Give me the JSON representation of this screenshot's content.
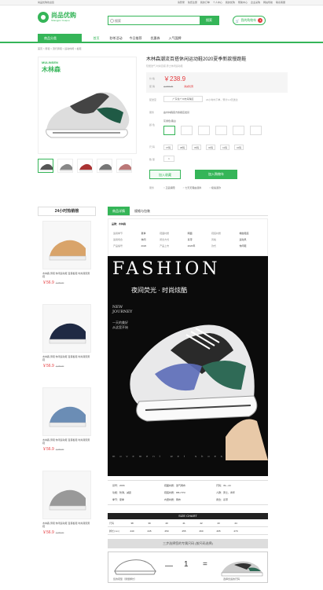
{
  "topbar": {
    "welcome": "尚品优购欢迎您",
    "links": [
      "请登录",
      "免费注册",
      "我的订单",
      "个人中心",
      "我的优购",
      "帮助中心",
      "企业采购",
      "网站导航",
      "联系客服"
    ]
  },
  "header": {
    "logo_name": "尚品优购",
    "logo_sub": "Shangpin Youqou",
    "search_placeholder": "搜索",
    "search_button": "搜索",
    "cart_label": "我的购物车",
    "cart_count": "8"
  },
  "nav": {
    "category": "商品分类",
    "items": [
      "首页",
      "秒杀活动",
      "今日推荐",
      "优惠券",
      "入气国牌"
    ]
  },
  "breadcrumb": "首页 > 男鞋 > 流行男鞋 > 运动休闲 > 板鞋",
  "gallery": {
    "brand_en": "MULINSEN",
    "brand_cn": "木林森"
  },
  "product": {
    "title": "木林森潮流百搭休闲运动鞋2020夏季新款慢跑鞋",
    "subtitle": "轻便透气 时尚百搭 男士休闲运动鞋",
    "price_label": "价 格",
    "price": "￥238.9",
    "orig_label": "促 销",
    "orig_price": "￥298.00",
    "promo_label": "满减优惠",
    "delivery_label": "配送至",
    "delivery_value": "广东省广州市海珠区",
    "delivery_note": "24小时内下单，预计1-3天送达",
    "service_label": "服务",
    "service_value": "由木林森官方旗舰店发货",
    "color_label": "颜 色",
    "color_value": "灰绿色/黑白",
    "size_label": "尺 码",
    "sizes": [
      "37码",
      "38码",
      "39码",
      "40码",
      "41码",
      "42码"
    ],
    "qty_label": "数 量",
    "qty": "1",
    "btn_fav": "加入收藏",
    "btn_cart": "加入购物车",
    "guarantee_label": "服务",
    "guarantees": [
      "正品保障",
      "七天无理由退换",
      "极速退款"
    ]
  },
  "sidebar": {
    "title": "24小时热销榜",
    "items": [
      {
        "desc": "木林森 男鞋 休闲运动鞋 百搭板鞋 时尚潮流男鞋",
        "price": "￥56.9",
        "orig": "￥98.00"
      },
      {
        "desc": "木林森 男鞋 休闲运动鞋 百搭板鞋 时尚潮流男鞋",
        "price": "￥56.9",
        "orig": "￥98.00"
      },
      {
        "desc": "木林森 男鞋 休闲运动鞋 百搭板鞋 时尚潮流男鞋",
        "price": "￥56.9",
        "orig": "￥98.00"
      },
      {
        "desc": "木林森 男鞋 休闲运动鞋 百搭板鞋 时尚潮流男鞋",
        "price": "￥56.9",
        "orig": "￥98.00"
      }
    ]
  },
  "detail": {
    "tabs": [
      "商品详情",
      "规格与包装"
    ],
    "brand_line": "品牌：木林森",
    "specs": [
      [
        "适用季节",
        "夏季",
        "鞋面材质",
        "网面",
        "鞋底材质",
        "橡胶鞋底"
      ],
      [
        "适用场合",
        "休闲",
        "闭合方式",
        "系带",
        "风格",
        "运动风"
      ],
      [
        "产品编号",
        "2020",
        "产品上市",
        "2020年",
        "款式",
        "休闲鞋"
      ]
    ],
    "poster_title": "FASHION",
    "poster_cn": "夜间荧光 · 时尚炫酷",
    "poster_new": "NEW\nJOURNEY",
    "poster_small": "一天的美好\n从这里开始",
    "poster_bottom": "movement  wet  shoes",
    "param": [
      [
        "货号：2066",
        "鞋面材质：透气网布",
        "尺码：39—44"
      ],
      [
        "功能：防滑，减震",
        "鞋底材质：RB+TPU",
        "人群：男士，青年"
      ],
      [
        "季节：夏季",
        "内里材质：网布",
        "闭合：系带"
      ]
    ],
    "size_chart_title": "SIZE CHART",
    "size_rows": [
      [
        "尺码",
        "38",
        "39",
        "40",
        "41",
        "42",
        "43",
        "44"
      ],
      [
        "脚长(mm)",
        "240",
        "245",
        "250",
        "255",
        "260",
        "265",
        "270"
      ]
    ],
    "compare_title": "三步选择您的专属尺码 (按尺码选择)",
    "compare_num": "1",
    "compare_cap_left": "您的鞋型（测量脚长）",
    "compare_cap_right": "选择合适的尺码"
  }
}
